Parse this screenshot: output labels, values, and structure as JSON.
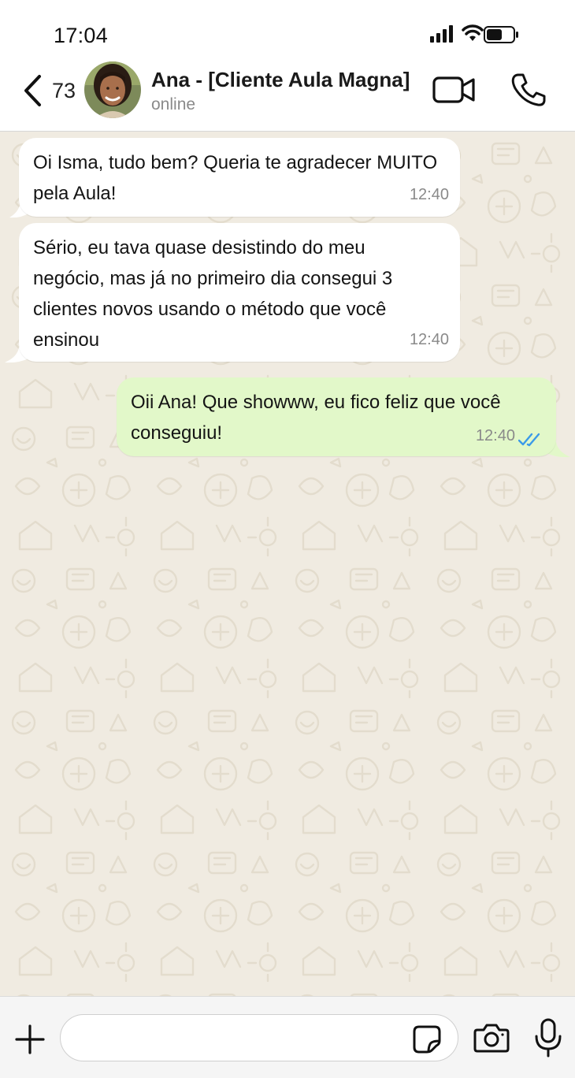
{
  "status_bar": {
    "time": "17:04",
    "icons": [
      "signal-icon",
      "wifi-icon",
      "battery-icon"
    ]
  },
  "header": {
    "back_icon": "chevron-left-icon",
    "unread_count": "73",
    "contact_name": "Ana - [Cliente Aula Magna]",
    "contact_status": "online",
    "actions": [
      "video-camera-icon",
      "phone-icon"
    ]
  },
  "messages": [
    {
      "direction": "incoming",
      "text": "Oi Isma, tudo bem? Queria te agradecer MUITO pela Aula!",
      "time": "12:40"
    },
    {
      "direction": "incoming",
      "text": "Sério, eu tava quase desistindo do meu negócio, mas já no primeiro dia consegui 3 clientes novos usando o método que você ensinou",
      "time": "12:40"
    },
    {
      "direction": "outgoing",
      "text": "Oii Ana! Que showww, eu fico feliz que você conseguiu!",
      "time": "12:40",
      "status": "read"
    }
  ],
  "input_bar": {
    "placeholder": "",
    "icons": [
      "plus-icon",
      "sticker-icon",
      "camera-icon",
      "microphone-icon"
    ]
  },
  "colors": {
    "chat_background": "#f0ebe1",
    "incoming_bubble": "#ffffff",
    "outgoing_bubble": "#e2f8c9",
    "read_receipt": "#3b9ae8",
    "header_background": "#ffffff"
  }
}
